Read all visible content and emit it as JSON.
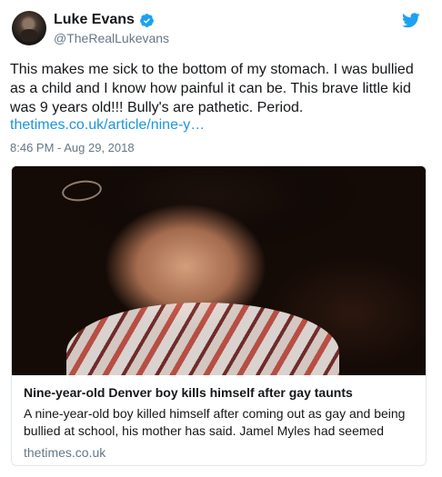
{
  "user": {
    "display_name": "Luke Evans",
    "handle": "@TheRealLukevans"
  },
  "tweet": {
    "text": "This makes me sick to the bottom of my stomach. I was bullied\nas a child and I know how painful it can be. This brave little kid\nwas 9 years old!!! Bully's are pathetic. Period.",
    "link": "thetimes.co.uk/article/nine-y…",
    "timestamp": "8:46 PM - Aug 29, 2018"
  },
  "card": {
    "title": "Nine-year-old Denver boy kills himself after gay taunts",
    "description": "A nine-year-old boy killed himself after coming out as gay and being bullied at school, his mother has said. Jamel Myles had seemed",
    "domain": "thetimes.co.uk"
  },
  "icons": {
    "verified": "verified-badge-icon",
    "brand": "twitter-bird-icon"
  },
  "colors": {
    "link": "#1b95e0",
    "verified": "#1da1f2",
    "twitter_brand": "#1da1f2",
    "secondary_text": "#657786"
  }
}
